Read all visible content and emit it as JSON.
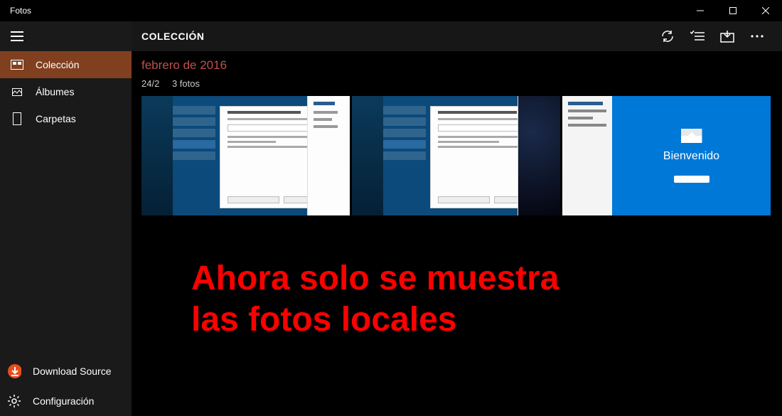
{
  "titlebar": {
    "app_name": "Fotos"
  },
  "sidebar": {
    "items": [
      {
        "label": "Colección",
        "icon": "collection-icon",
        "active": true
      },
      {
        "label": "Álbumes",
        "icon": "albums-icon",
        "active": false
      },
      {
        "label": "Carpetas",
        "icon": "folders-icon",
        "active": false
      }
    ],
    "bottom": [
      {
        "label": "Download Source",
        "icon": "download-source-icon"
      },
      {
        "label": "Configuración",
        "icon": "settings-icon"
      }
    ]
  },
  "header": {
    "title": "COLECCIÓN",
    "actions": [
      "refresh",
      "select",
      "import",
      "more"
    ]
  },
  "collection": {
    "month_label": "febrero de 2016",
    "day_label": "24/2",
    "count_label": "3 fotos",
    "welcome_text": "Bienvenido"
  },
  "annotation": {
    "line1": "Ahora solo se muestra",
    "line2": "las fotos locales"
  },
  "colors": {
    "accent": "#804020",
    "month": "#c0504d",
    "annotation": "#ff0000",
    "welcome_bg": "#0078d7"
  }
}
